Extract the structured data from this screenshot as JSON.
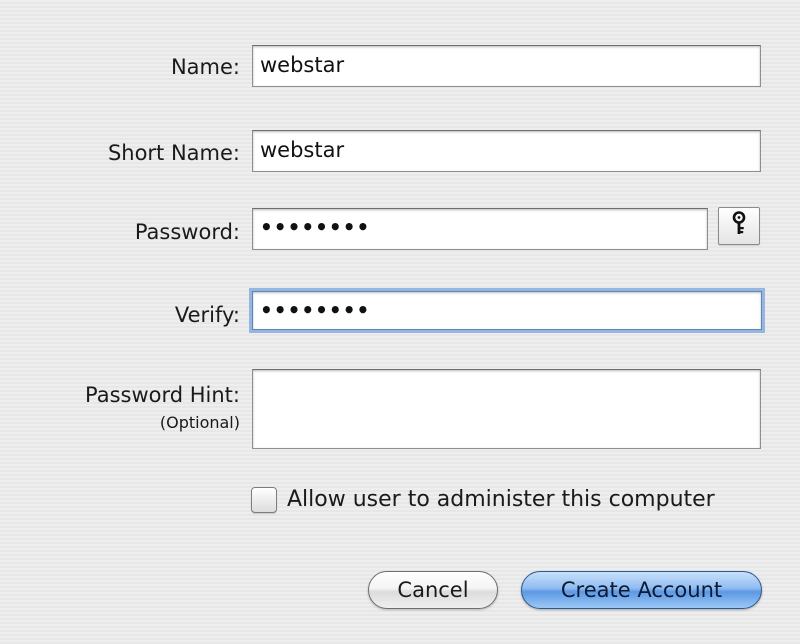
{
  "form": {
    "name_label": "Name:",
    "name_value": "webstar",
    "short_name_label": "Short Name:",
    "short_name_value": "webstar",
    "password_label": "Password:",
    "password_value": "••••••••",
    "verify_label": "Verify:",
    "verify_value": "••••••••",
    "hint_label": "Password Hint:",
    "hint_sublabel": "(Optional)",
    "hint_value": ""
  },
  "options": {
    "admin_checkbox_label": "Allow user to administer this computer",
    "admin_checked": false
  },
  "buttons": {
    "cancel_label": "Cancel",
    "create_label": "Create Account"
  },
  "icons": {
    "password_assistant": "key-icon"
  },
  "colors": {
    "default_button": "#5c98e3",
    "focus_ring": "#78a4de"
  }
}
